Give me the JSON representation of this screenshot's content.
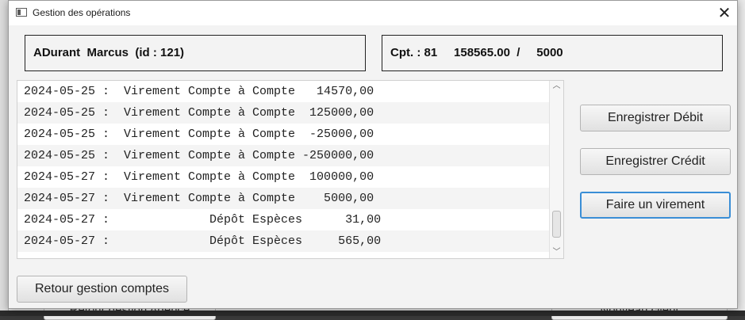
{
  "background": {
    "left_button": "Retour gestion Agence",
    "right_button": "Nouveau client"
  },
  "window": {
    "title": "Gestion des opérations",
    "close_glyph": "✕"
  },
  "client_info": "ADurant  Marcus  (id : 121)",
  "account_info": "Cpt. : 81     158565.00  /     5000",
  "operations": [
    "2024-05-25 :  Virement Compte à Compte   14570,00",
    "2024-05-25 :  Virement Compte à Compte  125000,00",
    "2024-05-25 :  Virement Compte à Compte  -25000,00",
    "2024-05-25 :  Virement Compte à Compte -250000,00",
    "2024-05-27 :  Virement Compte à Compte  100000,00",
    "2024-05-27 :  Virement Compte à Compte    5000,00",
    "2024-05-27 :              Dépôt Espèces      31,00",
    "2024-05-27 :              Dépôt Espèces     565,00"
  ],
  "scroll": {
    "up_glyph": "︿",
    "down_glyph": "﹀"
  },
  "buttons": {
    "debit": "Enregistrer Débit",
    "credit": "Enregistrer Crédit",
    "virement": "Faire un virement",
    "back": "Retour gestion comptes"
  },
  "colors": {
    "focus_border": "#3a8ed6"
  }
}
